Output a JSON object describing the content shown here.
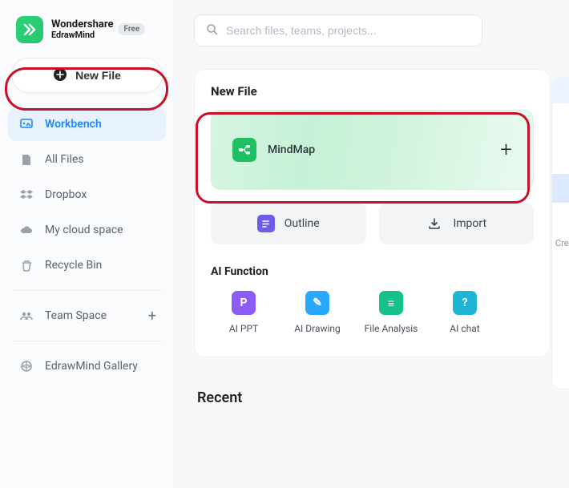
{
  "brand": {
    "line1": "Wondershare",
    "line2": "EdrawMind",
    "badge": "Free"
  },
  "sidebar": {
    "new_file": "New File",
    "items": [
      {
        "label": "Workbench"
      },
      {
        "label": "All Files"
      },
      {
        "label": "Dropbox"
      },
      {
        "label": "My cloud space"
      },
      {
        "label": "Recycle Bin"
      }
    ],
    "team_space": "Team Space",
    "gallery": "EdrawMind Gallery"
  },
  "search": {
    "placeholder": "Search files, teams, projects..."
  },
  "panel": {
    "title": "New File",
    "mindmap": "MindMap",
    "outline": "Outline",
    "import": "Import",
    "ai_title": "AI Function",
    "ai": [
      {
        "label": "AI PPT",
        "color": "#8b5cf6",
        "glyph": "P"
      },
      {
        "label": "AI Drawing",
        "color": "#2aa8ff",
        "glyph": "✎"
      },
      {
        "label": "File Analysis",
        "color": "#16c08a",
        "glyph": "≡"
      },
      {
        "label": "AI chat",
        "color": "#1fb6d6",
        "glyph": "?"
      }
    ]
  },
  "right_fragment": {
    "label": "Cre"
  },
  "recent_title": "Recent"
}
